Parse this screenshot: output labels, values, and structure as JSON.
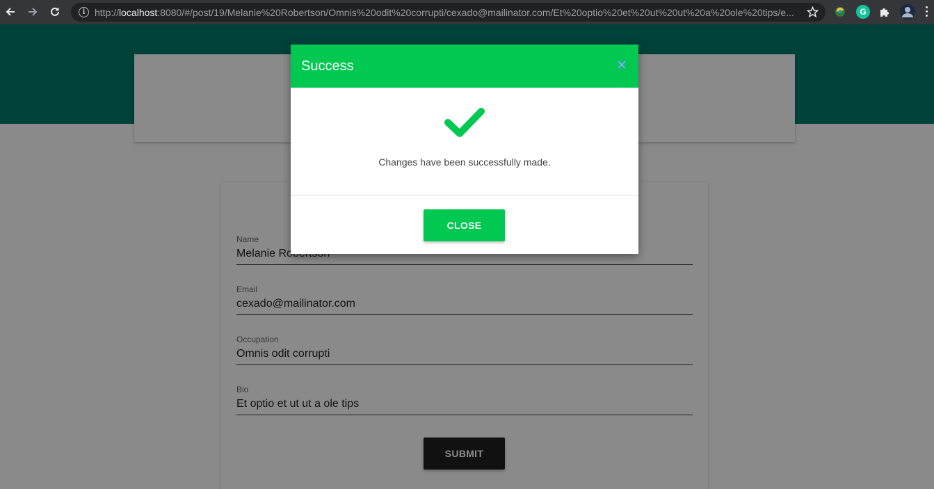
{
  "browser": {
    "url_prefix": "http://",
    "url_host": "localhost",
    "url_rest": ":8080/#/post/19/Melanie%20Robertson/Omnis%20odit%20corrupti/cexado@mailinator.com/Et%20optio%20et%20ut%20ut%20a%20ole%20tips/e...",
    "info_glyph": "i",
    "extension_g_label": "G"
  },
  "form": {
    "fields": [
      {
        "label": "Name",
        "value": "Melanie Robertson"
      },
      {
        "label": "Email",
        "value": "cexado@mailinator.com"
      },
      {
        "label": "Occupation",
        "value": "Omnis odit corrupti"
      },
      {
        "label": "Bio",
        "value": "Et optio et ut ut a ole tips"
      }
    ],
    "submit_label": "SUBMIT"
  },
  "modal": {
    "title": "Success",
    "message": "Changes have been successfully made.",
    "close_label": "CLOSE"
  },
  "colors": {
    "hero": "#00796b",
    "success": "#00c851",
    "submit": "#212121"
  },
  "icons": [
    "back-arrow-icon",
    "forward-arrow-icon",
    "reload-icon",
    "info-icon",
    "star-icon",
    "extension-icon",
    "grammarly-icon",
    "puzzle-icon",
    "avatar",
    "kebab-menu-icon",
    "close-x-icon",
    "checkmark-icon"
  ]
}
